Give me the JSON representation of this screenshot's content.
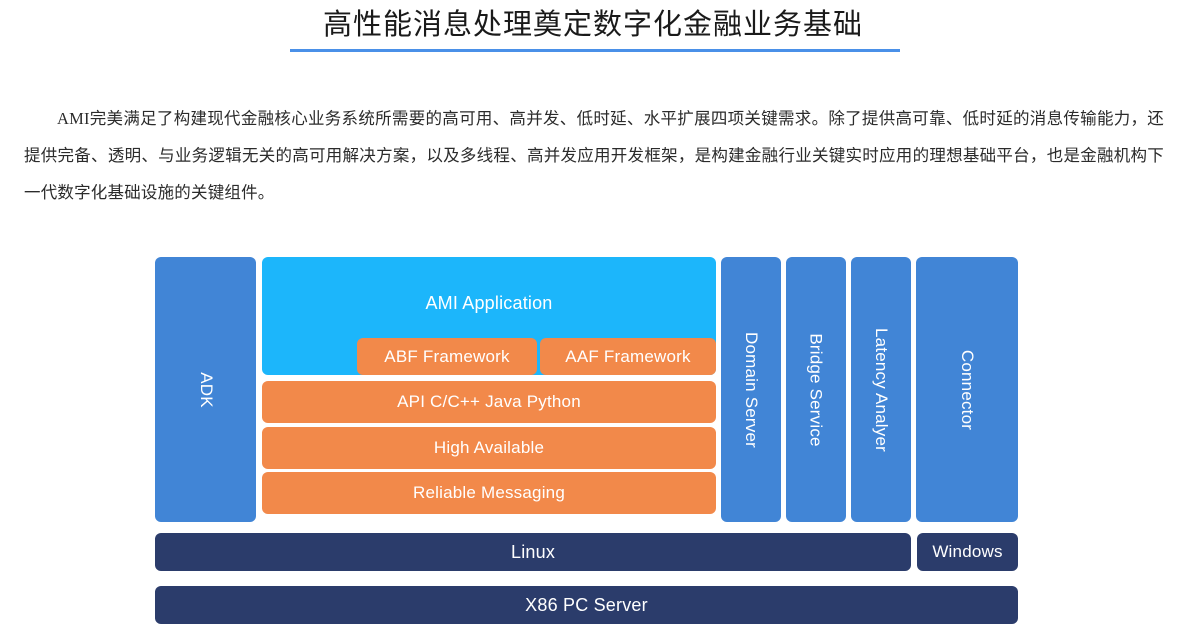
{
  "page": {
    "title": "高性能消息处理奠定数字化金融业务基础",
    "paragraph": "AMI完美满足了构建现代金融核心业务系统所需要的高可用、高并发、低时延、水平扩展四项关键需求。除了提供高可靠、低时延的消息传输能力，还提供完备、透明、与业务逻辑无关的高可用解决方案，以及多线程、高并发应用开发框架，是构建金融行业关键实时应用的理想基础平台，也是金融机构下一代数字化基础设施的关键组件。"
  },
  "colors": {
    "accent_rule": "#4a90e8",
    "blue": "#4185d6",
    "cyan": "#1cb6fb",
    "orange": "#f2894a",
    "navy": "#2b3c6b",
    "background": "#ffffff",
    "text": "#2b2b2b"
  },
  "diagram": {
    "left_column": {
      "adk": "ADK"
    },
    "core_stack": {
      "application": "AMI Application",
      "frameworks": [
        "ABF Framework",
        "AAF Framework"
      ],
      "layers": [
        "API C/C++ Java Python",
        "High Available",
        "Reliable Messaging"
      ]
    },
    "right_columns": [
      "Domain Server",
      "Bridge Service",
      "Latency Analyer",
      "Connector"
    ],
    "os_row": [
      "Linux",
      "Windows"
    ],
    "hardware_row": "X86 PC Server"
  }
}
